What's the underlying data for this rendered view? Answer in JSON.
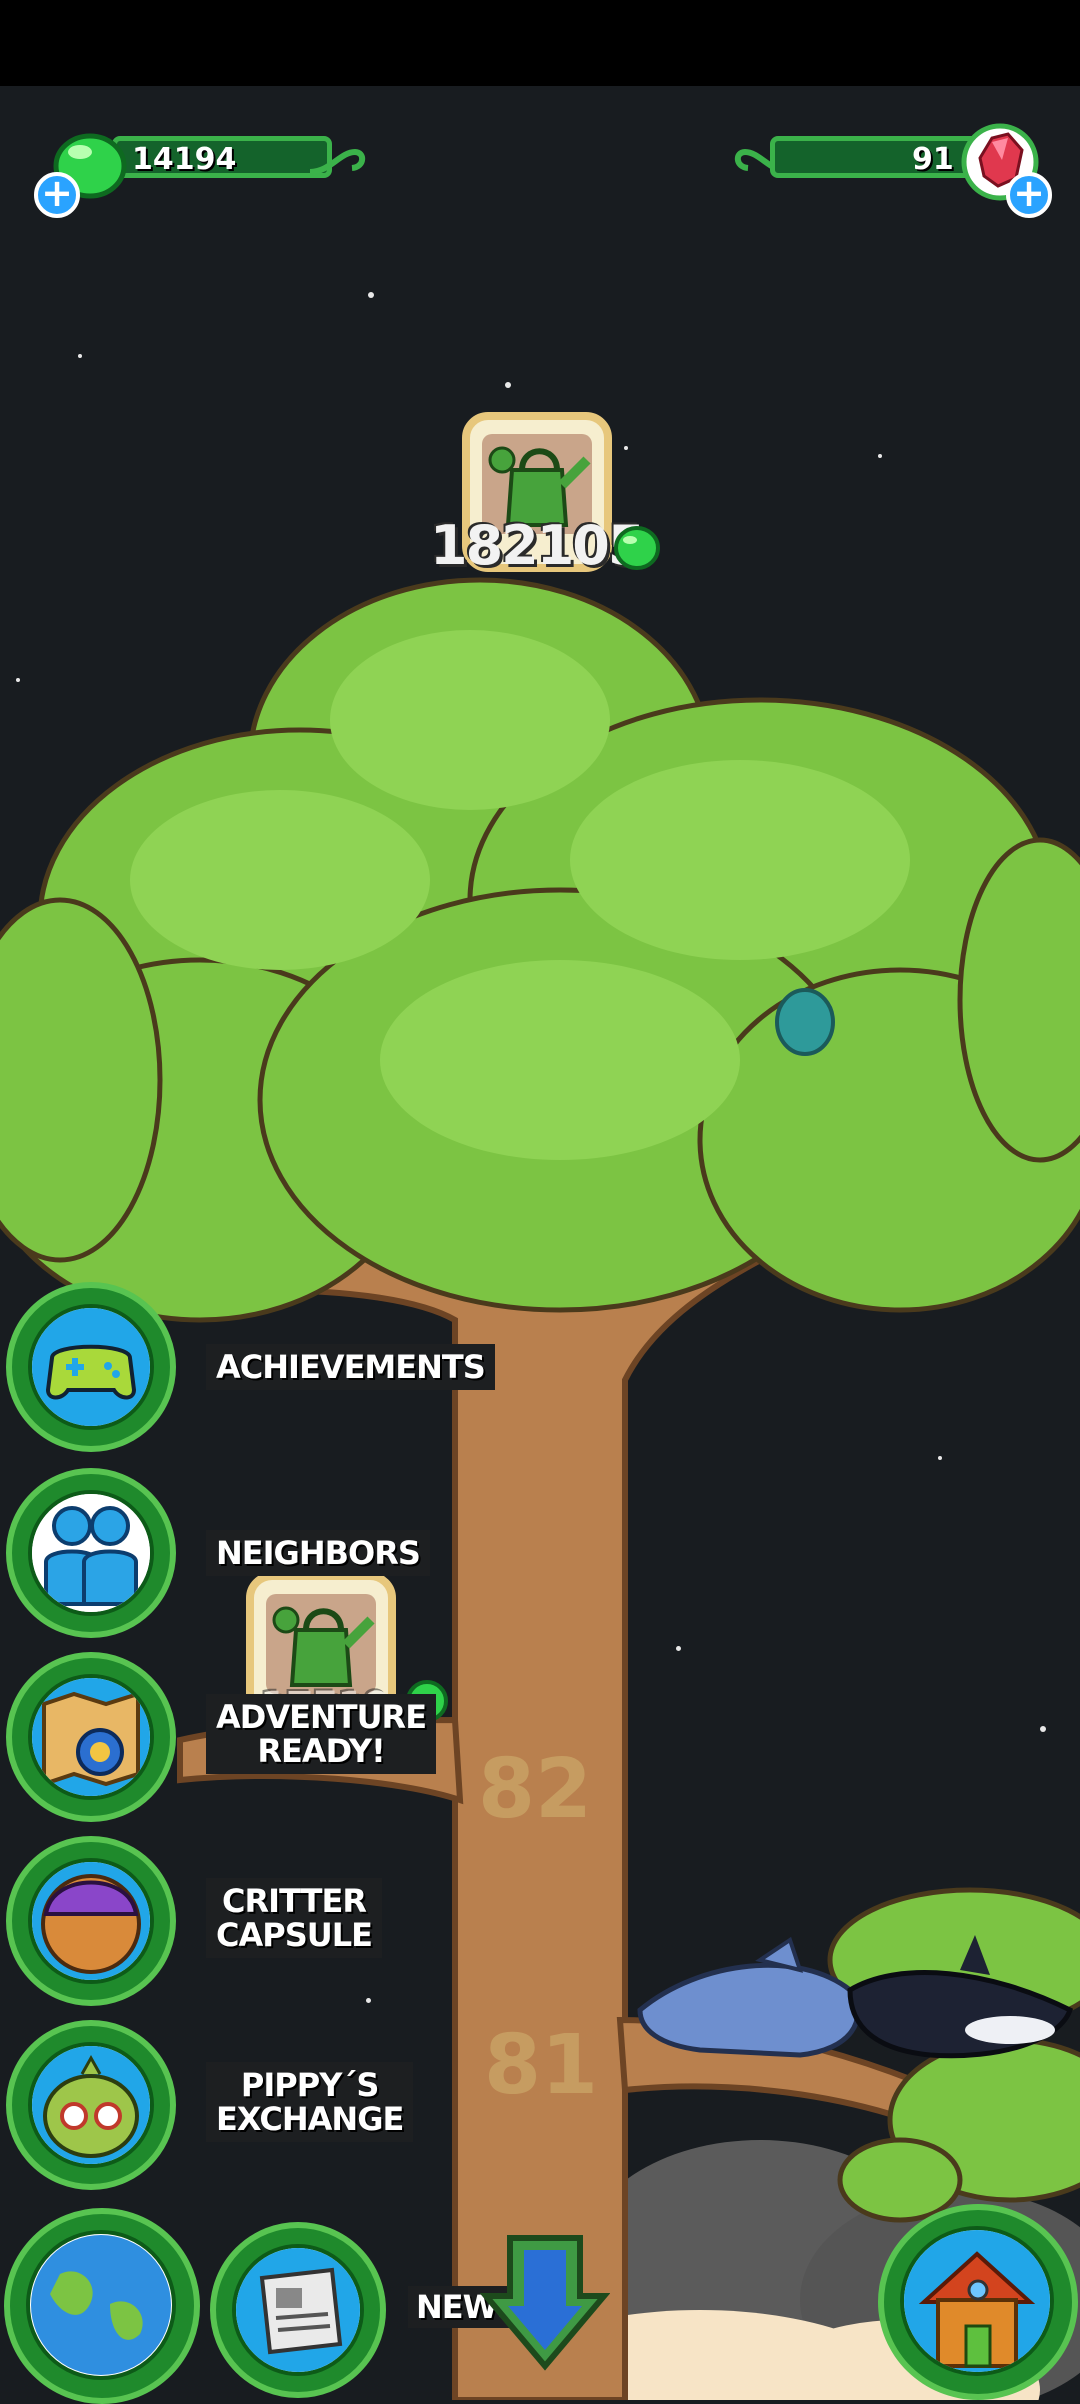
{
  "currency": {
    "droplets": "14194",
    "gems": "91"
  },
  "tree": {
    "watering_cost_top": "182105",
    "watering_cost_branch": "17519",
    "levels": [
      "82",
      "81"
    ]
  },
  "menu": {
    "achievements": "ACHIEVEMENTS",
    "neighbors": "NEIGHBORS",
    "adventure": "ADVENTURE\nREADY!",
    "critter_capsule": "CRITTER\nCAPSULE",
    "pippys_exchange": "PIPPY´S\nEXCHANGE",
    "news": "NEWS"
  },
  "icons": {
    "droplet": "green-droplet-icon",
    "gem": "red-gem-icon",
    "watering_can": "watering-can-icon",
    "controller": "controller-icon",
    "neighbors": "neighbors-icon",
    "map": "map-icon",
    "capsule": "capsule-icon",
    "pippy": "pippy-icon",
    "globe": "globe-icon",
    "newspaper": "newspaper-icon",
    "arrow": "down-arrow-icon",
    "home": "home-icon"
  },
  "colors": {
    "sky": "#181c20",
    "leaf": "#7cc443",
    "trunk": "#b9804e",
    "ui_green": "#3bb24a"
  }
}
